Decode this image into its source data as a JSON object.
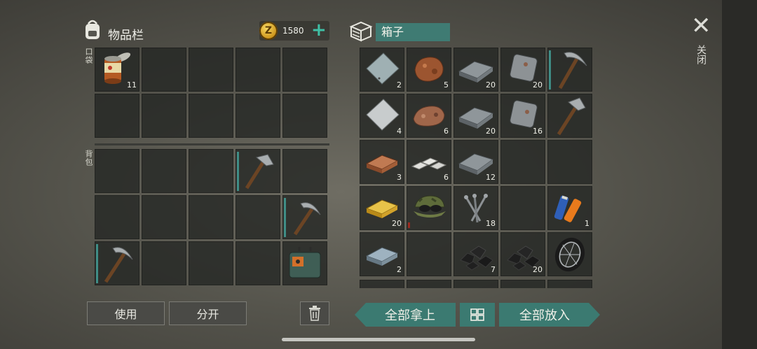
{
  "inventory": {
    "title": "物品栏",
    "pocket_label": "口袋",
    "backpack_label": "背包"
  },
  "currency": {
    "symbol": "Z",
    "amount": "1580",
    "add": "+"
  },
  "box": {
    "name": "箱子"
  },
  "close": {
    "icon": "✕",
    "label": "关闭"
  },
  "buttons": {
    "use": "使用",
    "split": "分开",
    "take_all": "全部拿上",
    "put_all": "全部放入"
  },
  "pocket_items": [
    {
      "name": "canned-food-icon",
      "count": "11"
    }
  ],
  "box_counts": {
    "r1": [
      "2",
      "5",
      "20",
      "20",
      ""
    ],
    "r2": [
      "4",
      "6",
      "20",
      "16",
      ""
    ],
    "r3": [
      "3",
      "6",
      "12",
      "",
      ""
    ],
    "r4": [
      "20",
      "",
      "18",
      "",
      "1"
    ],
    "r5": [
      "2",
      "",
      "7",
      "20",
      ""
    ]
  },
  "colors": {
    "accent": "#3b7a71",
    "slot": "#232522",
    "coin": "#e0b53a"
  }
}
